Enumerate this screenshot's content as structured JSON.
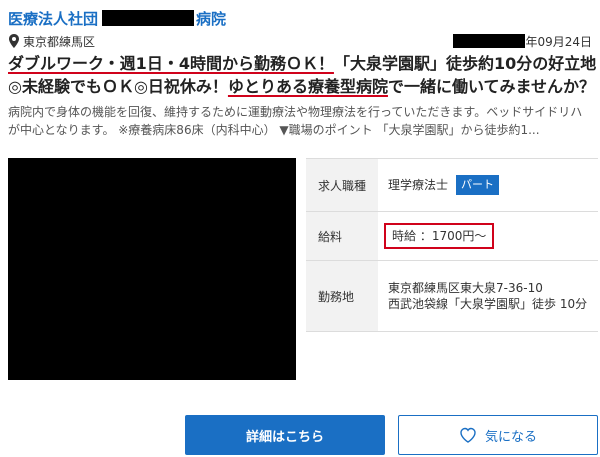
{
  "header": {
    "org_prefix": "医療法人社団",
    "org_suffix": "病院",
    "location": "東京都練馬区",
    "date": "年09月24日"
  },
  "title": {
    "part1": "ダブルワーク・週1日・4時間から勤務ＯＫ！",
    "part2": "「大泉学園駅」徒歩約10分の好立地◎未経験でもＯＫ◎日祝休み！",
    "part3": "ゆとりある療養型病院",
    "part4": "で一緒に働いてみませんか？"
  },
  "description": "病院内で身体の機能を回復、維持するために運動療法や物理療法を行っていただきます。ベッドサイドリハが中心となります。 ※療養病床86床（内科中心） ▼職場のポイント 「大泉学園駅」から徒歩約1...",
  "info": {
    "job_label": "求人職種",
    "job_value": "理学療法士",
    "job_badge": "パート",
    "salary_label": "給料",
    "salary_value": "時給 ：1700円〜",
    "location_label": "勤務地",
    "location_line1": "東京都練馬区東大泉7-36-10",
    "location_line2": "西武池袋線「大泉学園駅」徒歩 10分"
  },
  "buttons": {
    "detail": "詳細はこちら",
    "favorite": "気になる"
  },
  "icons": {
    "location": "map-pin-icon",
    "favorite": "heart-icon"
  },
  "colors": {
    "link": "#1a6fc4",
    "accent_red": "#d0021b"
  }
}
